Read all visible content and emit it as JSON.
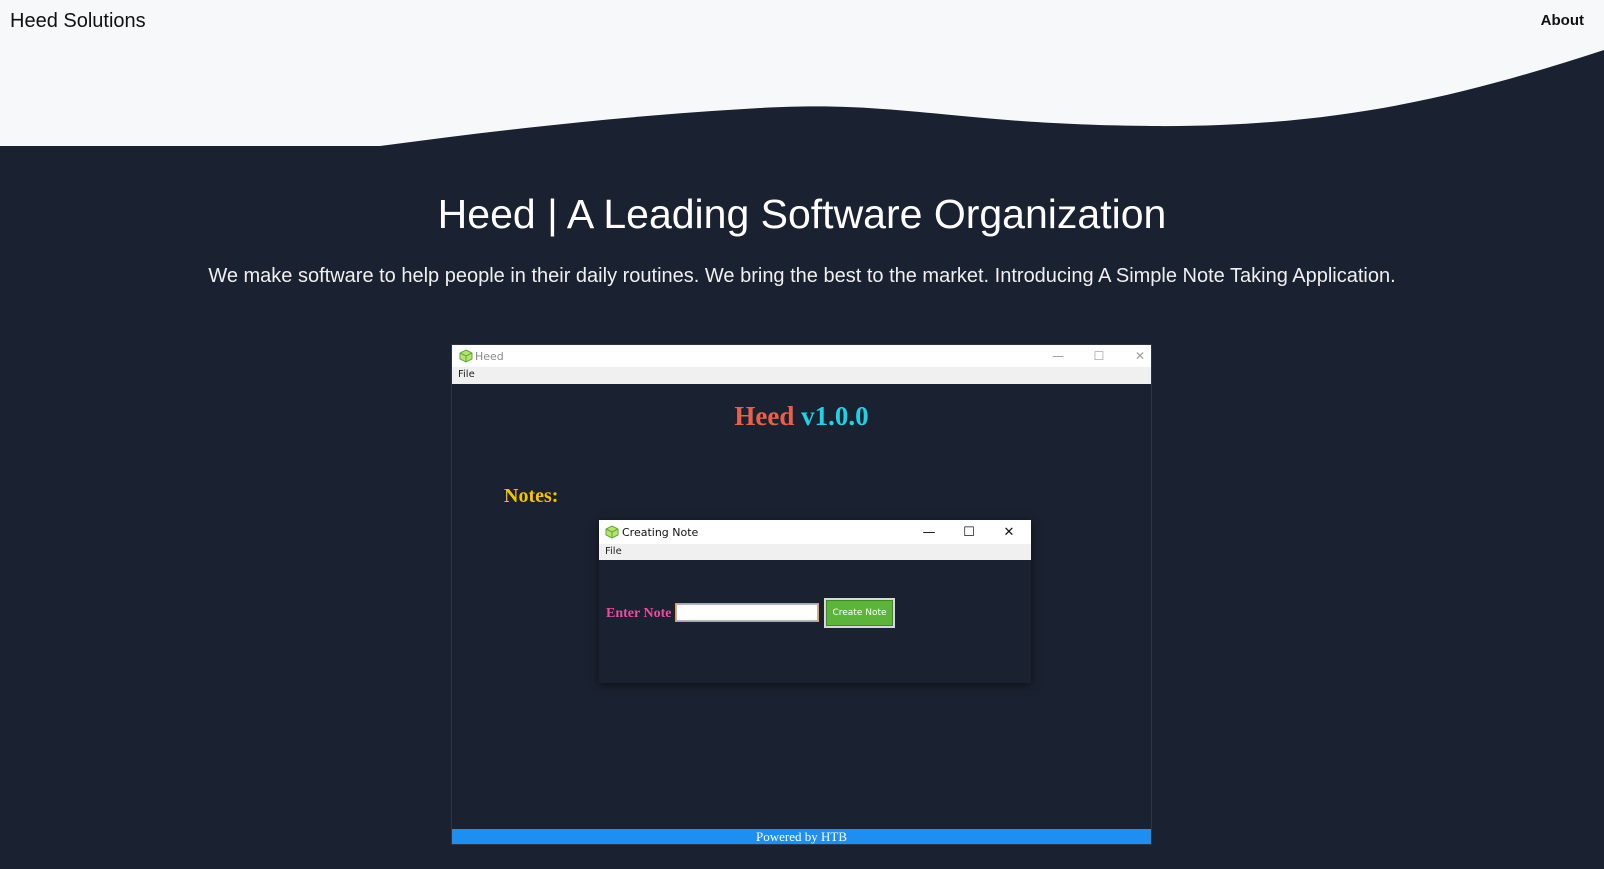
{
  "header": {
    "brand": "Heed Solutions",
    "nav_about": "About"
  },
  "hero": {
    "title": "Heed | A Leading Software Organization",
    "subtitle": "We make software to help people in their daily routines. We bring the best to the market. Introducing A Simple Note Taking Application."
  },
  "app": {
    "window_title": "Heed",
    "menu_file": "File",
    "controls": {
      "minimize": "—",
      "maximize": "☐",
      "close": "✕"
    },
    "heading_name": "Heed",
    "heading_version": "v1.0.0",
    "notes_label": "Notes:",
    "footer": "Powered by HTB",
    "colors": {
      "heading_name": "#e8604a",
      "heading_version": "#1fd3e6",
      "notes_label": "#f5c400",
      "footer_bg": "#1e8ef0"
    }
  },
  "dialog": {
    "window_title": "Creating Note",
    "menu_file": "File",
    "controls": {
      "minimize": "—",
      "maximize": "☐",
      "close": "✕"
    },
    "enter_label": "Enter Note",
    "input_value": "",
    "create_button": "Create Note",
    "colors": {
      "enter_label": "#e84ea0",
      "create_button": "#5cb43a"
    }
  },
  "icons": {
    "app_icon": "green-cube-icon"
  }
}
